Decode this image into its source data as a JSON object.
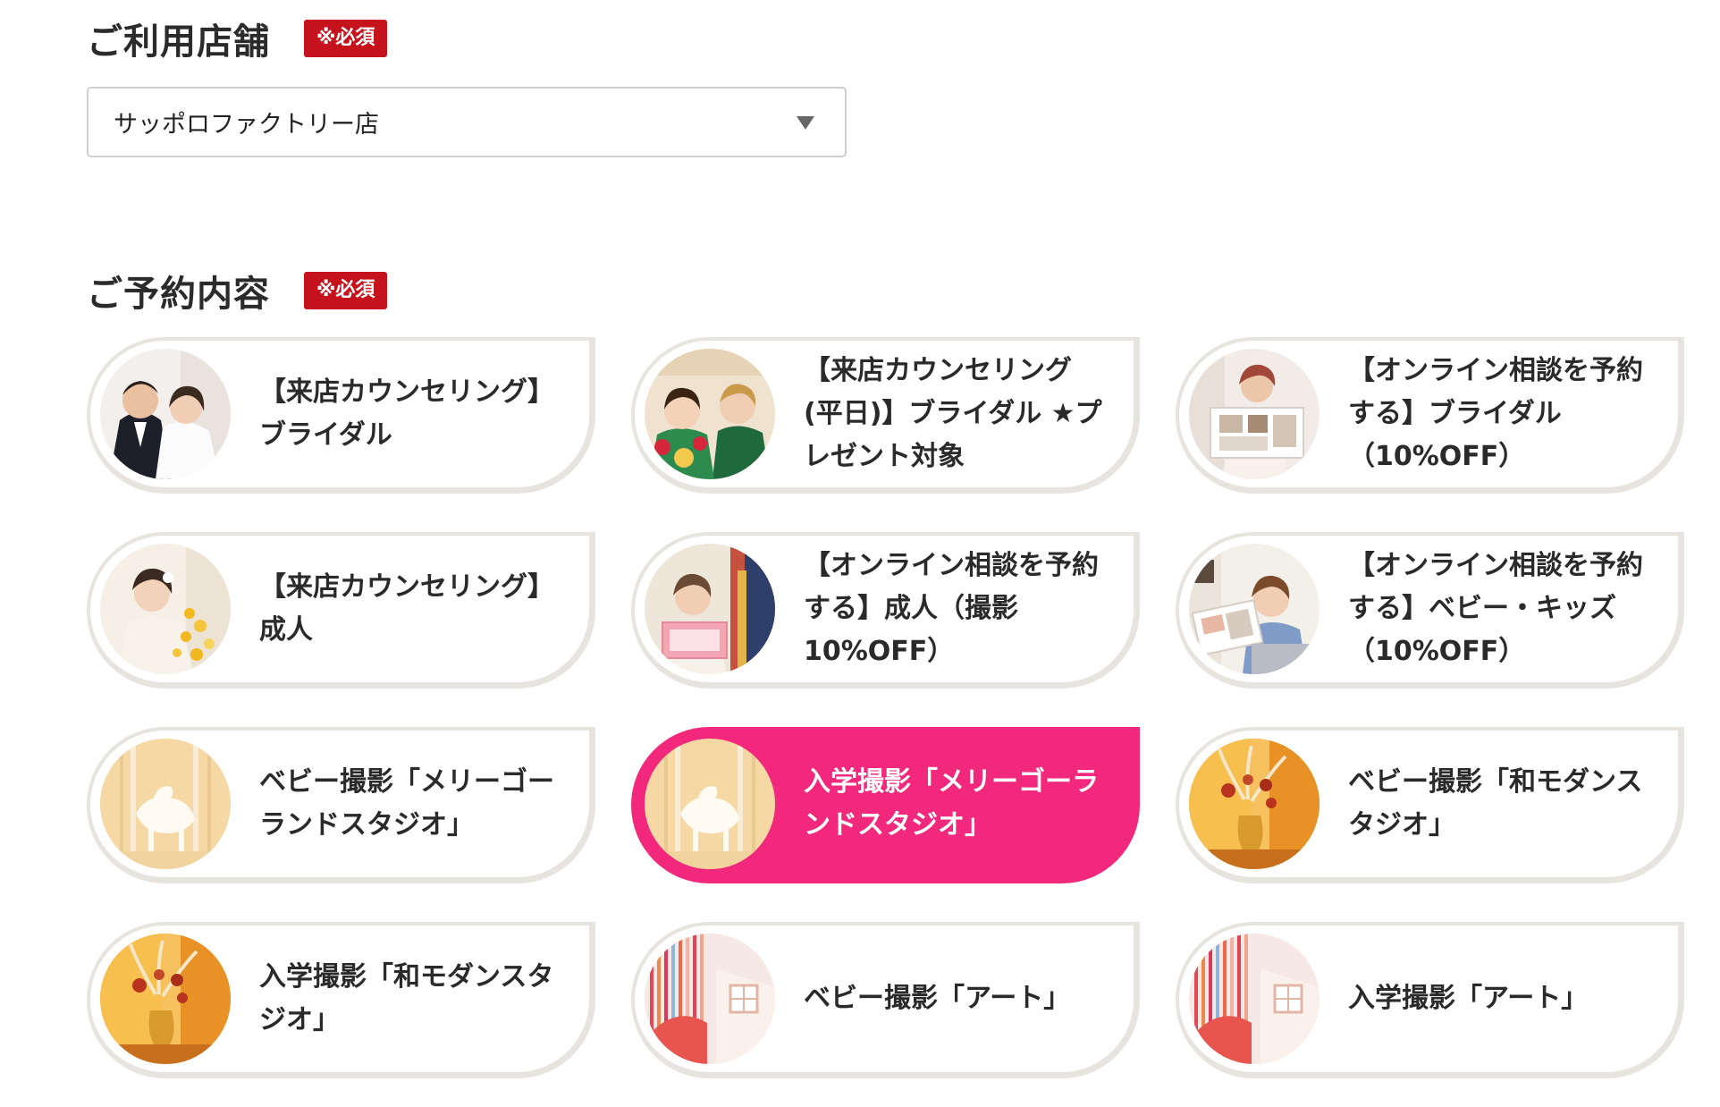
{
  "store_section": {
    "title": "ご利用店舗",
    "required_badge": "※必須",
    "select": {
      "selected_value": "サッポロファクトリー店",
      "icon": "dropdown-triangle-icon"
    }
  },
  "plan_section": {
    "title": "ご予約内容",
    "required_badge": "※必須",
    "selected_index": 7,
    "plans": [
      {
        "label": "【来店カウンセリング】\nブライダル",
        "thumb": "bridal-couple",
        "selected": false
      },
      {
        "label": "【来店カウンセリング\n(平日)】ブライダル ★プ\nレゼント対象",
        "thumb": "kimono-couple",
        "selected": false
      },
      {
        "label": "【オンライン相談を予約\nする】ブライダル\n（10%OFF）",
        "thumb": "online-album",
        "selected": false
      },
      {
        "label": "【来店カウンセリング】\n成人",
        "thumb": "furisode-woman",
        "selected": false
      },
      {
        "label": "【オンライン相談を予約\nする】成人（撮影\n10%OFF）",
        "thumb": "kimono-shop",
        "selected": false
      },
      {
        "label": "【オンライン相談を予約\nする】ベビー・キッズ\n（10%OFF）",
        "thumb": "online-laptop",
        "selected": false
      },
      {
        "label": "ベビー撮影「メリーゴー\nランドスタジオ」",
        "thumb": "merry-go-round",
        "selected": false
      },
      {
        "label": "入学撮影「メリーゴーラ\nンドスタジオ」",
        "thumb": "merry-go-round",
        "selected": true
      },
      {
        "label": "ベビー撮影「和モダンス\nタジオ」",
        "thumb": "wa-modern",
        "selected": false
      },
      {
        "label": "入学撮影「和モダンスタ\nジオ」",
        "thumb": "wa-modern",
        "selected": false
      },
      {
        "label": "ベビー撮影「アート」",
        "thumb": "art-studio",
        "selected": false
      },
      {
        "label": "入学撮影「アート」",
        "thumb": "art-studio",
        "selected": false
      }
    ]
  },
  "colors": {
    "required_badge": "#c6121c",
    "selected_card": "#f2287d",
    "card_border": "#e7e4df"
  }
}
